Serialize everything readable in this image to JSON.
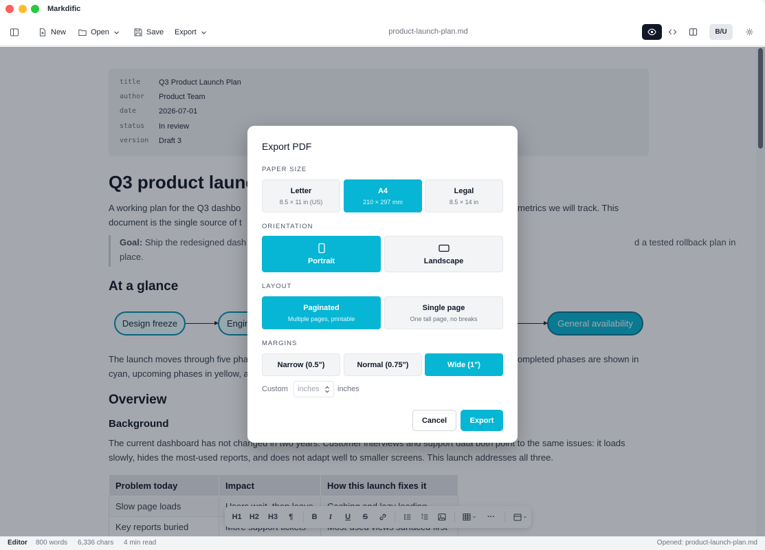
{
  "window": {
    "app_title": "Markdific"
  },
  "toolbar": {
    "new_label": "New",
    "open_label": "Open",
    "save_label": "Save",
    "export_label": "Export",
    "document_name": "product-launch-plan.md",
    "format_label": "B/U"
  },
  "frontmatter": [
    {
      "key": "title",
      "value": "Q3 Product Launch Plan"
    },
    {
      "key": "author",
      "value": "Product Team"
    },
    {
      "key": "date",
      "value": "2026-07-01"
    },
    {
      "key": "status",
      "value": "In review"
    },
    {
      "key": "version",
      "value": "Draft 3"
    }
  ],
  "document": {
    "heading": "Q3 product launc",
    "intro_line1_start": "A working plan for the Q3 dashbo",
    "intro_line1_end": "metrics we will track. This",
    "intro_line2": "document is the single source of t",
    "quote_label": "Goal:",
    "quote_text_start": " Ship the redesigned dash",
    "quote_text_end": "d a tested rollback plan in",
    "quote_line2": "place.",
    "glance_heading": "At a glance",
    "phase_design": "Design freeze",
    "phase_engineering": "Engin",
    "phase_ga": "General availability",
    "launch_line1_start": "The launch moves through five pha",
    "launch_line1_end": "ompleted phases are shown in",
    "launch_line2": "cyan, upcoming phases in yellow, a",
    "overview_heading": "Overview",
    "background_heading": "Background",
    "bg_line1": "The current dashboard has not changed in two years. Customer interviews and support data both point to the same issues: it loads",
    "bg_line2": "slowly, hides the most-used reports, and does not adapt well to smaller screens. This launch addresses all three.",
    "table_headers": [
      "Problem today",
      "Impact",
      "How this launch fixes it"
    ],
    "table_rows": [
      [
        "Slow page loads",
        "Users wait, then leave",
        "Caching and lazy loading"
      ],
      [
        "Key reports buried",
        "More support tickets",
        "Most-used views surfaced first"
      ]
    ]
  },
  "format_bar": {
    "h1": "H1",
    "h2": "H2",
    "h3": "H3",
    "para": "¶",
    "bold": "B",
    "italic": "I",
    "underline": "U",
    "strike": "S",
    "more": "···"
  },
  "status_bar": {
    "mode": "Editor",
    "words": "800 words",
    "chars": "6,336 chars",
    "read_time": "4 min read",
    "opened": "Opened: product-launch-plan.md"
  },
  "dialog": {
    "title": "Export PDF",
    "paper_size_label": "PAPER SIZE",
    "paper_sizes": [
      {
        "name": "Letter",
        "dims": "8.5 × 11 in (US)"
      },
      {
        "name": "A4",
        "dims": "210 × 297 mm"
      },
      {
        "name": "Legal",
        "dims": "8.5 × 14 in"
      }
    ],
    "selected_paper": "A4",
    "orientation_label": "ORIENTATION",
    "orientations": [
      "Portrait",
      "Landscape"
    ],
    "selected_orientation": "Portrait",
    "layout_label": "LAYOUT",
    "layouts": [
      {
        "name": "Paginated",
        "desc": "Multiple pages, printable"
      },
      {
        "name": "Single page",
        "desc": "One tall page, no breaks"
      }
    ],
    "selected_layout": "Paginated",
    "margins_label": "MARGINS",
    "margins": [
      "Narrow (0.5\")",
      "Normal (0.75\")",
      "Wide (1\")"
    ],
    "selected_margin": "Wide (1\")",
    "custom_label": "Custom",
    "custom_placeholder": "inches",
    "custom_unit": "inches",
    "cancel_label": "Cancel",
    "export_label": "Export"
  },
  "colors": {
    "accent": "#06b6d4",
    "traffic_red": "#fe5f57",
    "traffic_yellow": "#febc2e",
    "traffic_green": "#28c840"
  }
}
